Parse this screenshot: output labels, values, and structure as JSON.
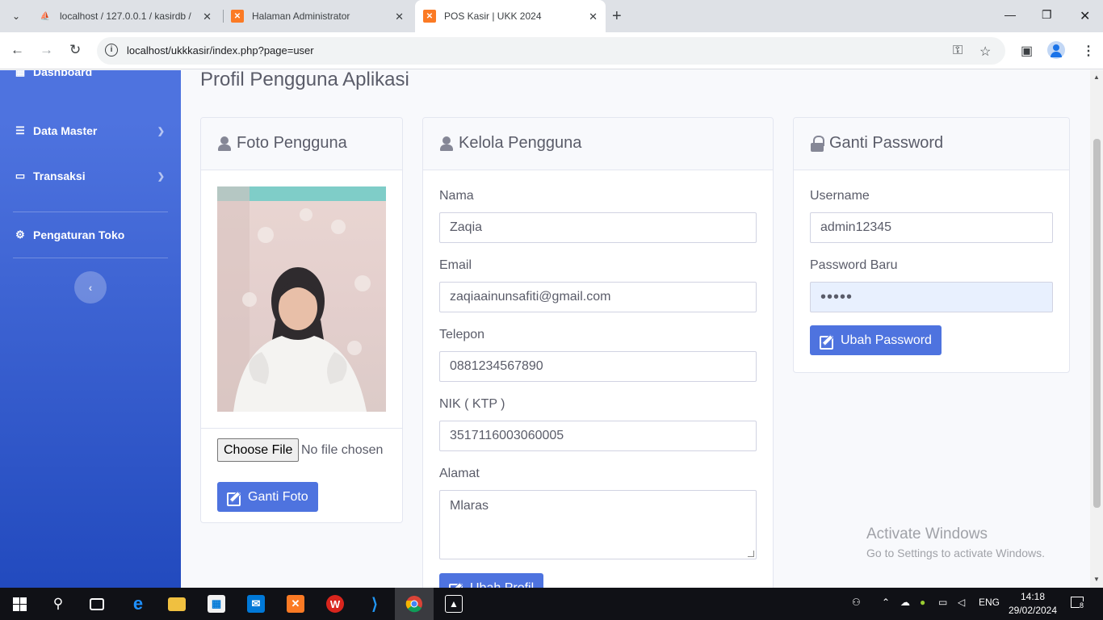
{
  "browser": {
    "tabs": [
      {
        "title": "localhost / 127.0.0.1 / kasirdb /",
        "favicon": "phpmyadmin-icon"
      },
      {
        "title": "Halaman Administrator",
        "favicon": "xampp-icon"
      },
      {
        "title": "POS Kasir | UKK 2024",
        "favicon": "xampp-icon",
        "active": true
      }
    ],
    "url": "localhost/ukkkasir/index.php?page=user"
  },
  "sidebar": {
    "items": [
      {
        "label": "Dashboard",
        "icon": "dashboard-icon"
      },
      {
        "label": "Data Master",
        "icon": "database-icon"
      },
      {
        "label": "Transaksi",
        "icon": "desktop-icon"
      },
      {
        "label": "Pengaturan Toko",
        "icon": "cogs-icon"
      }
    ],
    "toggle_glyph": "‹"
  },
  "page": {
    "title": "Profil Pengguna Aplikasi"
  },
  "foto_card": {
    "title": "Foto Pengguna",
    "choose_file_label": "Choose File",
    "no_file_text": "No file chosen",
    "button_label": "Ganti Foto"
  },
  "kelola_card": {
    "title": "Kelola Pengguna",
    "fields": {
      "nama": {
        "label": "Nama",
        "value": "Zaqia"
      },
      "email": {
        "label": "Email",
        "value": "zaqiaainunsafiti@gmail.com"
      },
      "telepon": {
        "label": "Telepon",
        "value": "0881234567890"
      },
      "nik": {
        "label": "NIK ( KTP )",
        "value": "3517116003060005"
      },
      "alamat": {
        "label": "Alamat",
        "value": "Mlaras"
      }
    },
    "button_label": "Ubah Profil"
  },
  "password_card": {
    "title": "Ganti Password",
    "username_label": "Username",
    "username_value": "admin12345",
    "password_label": "Password Baru",
    "password_value": "•••••",
    "button_label": "Ubah Password"
  },
  "watermark": {
    "line1": "Activate Windows",
    "line2": "Go to Settings to activate Windows."
  },
  "taskbar": {
    "language": "ENG",
    "time": "14:18",
    "date": "29/02/2024",
    "notification_count": "8"
  },
  "colors": {
    "primary": "#4e73df",
    "sidebar_gradient_end": "#224abe"
  }
}
